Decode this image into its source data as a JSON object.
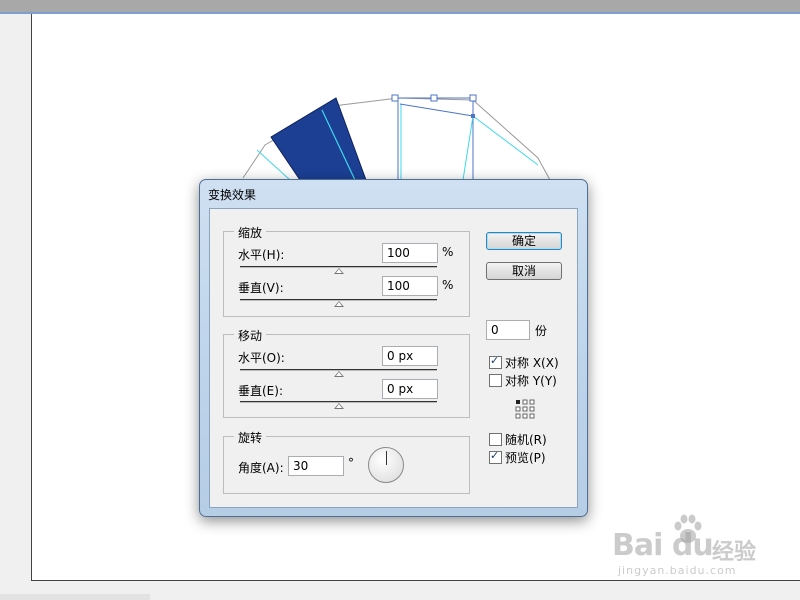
{
  "dialog": {
    "title": "变换效果",
    "scale": {
      "label": "缩放",
      "horizontal_label": "水平(H):",
      "horizontal_value": "100",
      "horizontal_unit": "%",
      "vertical_label": "垂直(V):",
      "vertical_value": "100",
      "vertical_unit": "%"
    },
    "move": {
      "label": "移动",
      "horizontal_label": "水平(O):",
      "horizontal_value": "0 px",
      "vertical_label": "垂直(E):",
      "vertical_value": "0 px"
    },
    "rotate": {
      "label": "旋转",
      "angle_label": "角度(A):",
      "angle_value": "30",
      "angle_unit": "°"
    },
    "buttons": {
      "ok": "确定",
      "cancel": "取消"
    },
    "copies": {
      "value": "0",
      "unit": "份"
    },
    "options": {
      "reflect_x": {
        "label": "对称 X(X)",
        "checked": true
      },
      "reflect_y": {
        "label": "对称 Y(Y)",
        "checked": false
      },
      "random": {
        "label": "随机(R)",
        "checked": false
      },
      "preview": {
        "label": "预览(P)",
        "checked": true
      }
    },
    "reference_point_icon": "reference-point-grid-icon",
    "dial_icon": "rotation-dial-icon"
  },
  "watermark": {
    "logo": "Bai du",
    "product": "经验",
    "url": "jingyan.baidu.com"
  },
  "colors": {
    "shape_fill": "#1c3f94",
    "guide_cyan": "#3fd9ea",
    "selection_blue": "#4c74c9",
    "dialog_frame": "#bcd3ea"
  }
}
